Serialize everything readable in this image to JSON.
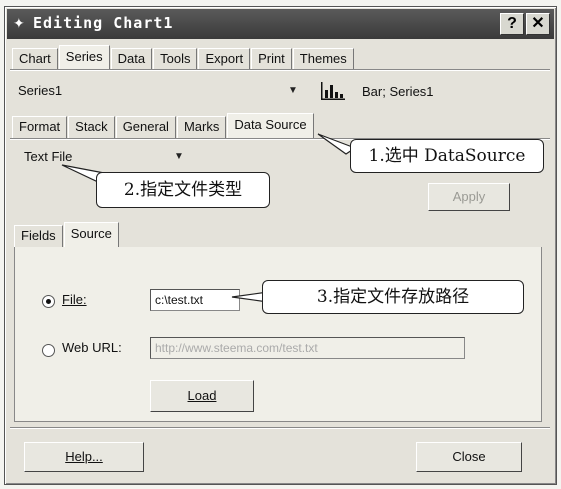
{
  "window": {
    "title": "Editing Chart1",
    "app_icon": "chart-app-icon",
    "help_glyph": "?",
    "close_glyph": "✕"
  },
  "main_tabs": [
    "Chart",
    "Series",
    "Data",
    "Tools",
    "Export",
    "Print",
    "Themes"
  ],
  "series_select": {
    "value": "Series1"
  },
  "series_info": {
    "icon": "bar-chart-icon",
    "text": "Bar; Series1"
  },
  "sub_tabs": [
    "Format",
    "Stack",
    "General",
    "Marks",
    "Data Source"
  ],
  "source_type": {
    "value": "Text File"
  },
  "apply_label": "Apply",
  "source_tabs": [
    "Fields",
    "Source"
  ],
  "file_option": {
    "label": "File:",
    "value": "c:\\test.txt",
    "checked": true
  },
  "web_option": {
    "label": "Web URL:",
    "value": "http://www.steema.com/test.txt",
    "checked": false
  },
  "load_label": "Load",
  "help_label": "Help...",
  "close_label": "Close",
  "callouts": {
    "c1": "1.选中 DataSource",
    "c2": "2.指定文件类型",
    "c3": "3.指定文件存放路径"
  }
}
